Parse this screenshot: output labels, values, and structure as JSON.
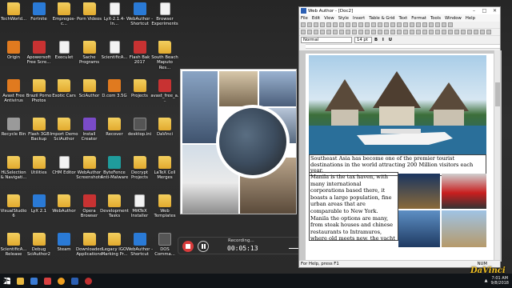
{
  "desktop": {
    "icons": [
      {
        "label": "TechWorld...",
        "kind": "folder"
      },
      {
        "label": "Fortnite",
        "kind": "blue"
      },
      {
        "label": "Empregos-c...",
        "kind": "folder"
      },
      {
        "label": "Porn Videos",
        "kind": "folder"
      },
      {
        "label": "LyX-2.1.4-In...",
        "kind": "doc"
      },
      {
        "label": "WebAuthor - Shortcut",
        "kind": "blue"
      },
      {
        "label": "Browser Experiments",
        "kind": "doc"
      },
      {
        "label": "Origin",
        "kind": "orange"
      },
      {
        "label": "Apowersoft Free Scre...",
        "kind": "red"
      },
      {
        "label": "Execulet",
        "kind": "doc"
      },
      {
        "label": "Sache Programs",
        "kind": "folder"
      },
      {
        "label": "ScientificA...",
        "kind": "doc"
      },
      {
        "label": "Flash Bak 2017",
        "kind": "red"
      },
      {
        "label": "South Beach Maputo Res...",
        "kind": "folder"
      },
      {
        "label": "Avast Free Antivirus",
        "kind": "orange"
      },
      {
        "label": "Brazil Porno Photos",
        "kind": "folder"
      },
      {
        "label": "Exotic Cars",
        "kind": "folder"
      },
      {
        "label": "SciAuthor",
        "kind": "folder"
      },
      {
        "label": "D.com 3.5G",
        "kind": "orange"
      },
      {
        "label": "Projects",
        "kind": "folder"
      },
      {
        "label": "avast_free_a...",
        "kind": "red"
      },
      {
        "label": "Recycle Bin",
        "kind": "grey"
      },
      {
        "label": "Flash 3GB Backup",
        "kind": "folder"
      },
      {
        "label": "Import Demo SciAuthor",
        "kind": "folder"
      },
      {
        "label": "Install Creator",
        "kind": "purple"
      },
      {
        "label": "Recover",
        "kind": "folder"
      },
      {
        "label": "desktop.ini",
        "kind": "dark"
      },
      {
        "label": "DaVinci",
        "kind": "folder"
      },
      {
        "label": "HLSelection & Navigati...",
        "kind": "folder"
      },
      {
        "label": "Utilities",
        "kind": "folder"
      },
      {
        "label": "CHM Editor",
        "kind": "doc"
      },
      {
        "label": "WebAuthor Screenshots",
        "kind": "folder"
      },
      {
        "label": "ByteFence Anti-Malware",
        "kind": "teal"
      },
      {
        "label": "Decrypt Projects",
        "kind": "folder"
      },
      {
        "label": "LaTeX Cell Merges",
        "kind": "folder"
      },
      {
        "label": "VisualStudio6",
        "kind": "folder"
      },
      {
        "label": "LyX 2.1",
        "kind": "blue"
      },
      {
        "label": "WebAuthor",
        "kind": "folder"
      },
      {
        "label": "Opera Browser",
        "kind": "red"
      },
      {
        "label": "Development Tasks",
        "kind": "folder"
      },
      {
        "label": "MiKTeX Installer",
        "kind": "doc"
      },
      {
        "label": "Web Templates",
        "kind": "folder"
      },
      {
        "label": "ScientificA... Release",
        "kind": "folder"
      },
      {
        "label": "Debug SciAuthor2",
        "kind": "folder"
      },
      {
        "label": "Steam",
        "kind": "blue"
      },
      {
        "label": "Downloaded Applications",
        "kind": "folder"
      },
      {
        "label": "Legacy IGO Marking Pr...",
        "kind": "folder"
      },
      {
        "label": "WebAuthor - Shortcut",
        "kind": "blue"
      },
      {
        "label": "DOS Comma...",
        "kind": "dark"
      },
      {
        "label": "High-Logic FontCreator",
        "kind": "red"
      }
    ]
  },
  "recorder": {
    "status": "Recording...",
    "time": "00:05:13",
    "volume": 0.65
  },
  "app": {
    "title": "Web Author - [Doc2]",
    "menu": [
      "File",
      "Edit",
      "View",
      "Style",
      "Insert",
      "Table & Grid",
      "Text",
      "Format",
      "Tools",
      "Window",
      "Help"
    ],
    "style_value": "Normal",
    "font_size_value": "14 pt",
    "caption": "Southeast Asia has become one of the premier tourist destinations in the world attracting 200 Million visitors each year.",
    "body": "Manila is the tax haven, with many international corporations based there, it boasts a large population, fine urban areas that are comparable to New York. Manila the options are many, from steak houses and chinese restaurants to Intramuros, where old meets new, the yacht club, sgh",
    "status_left": "For Help, press F1",
    "status_right": "NUM"
  },
  "taskbar": {
    "time": "7:01 AM",
    "date": "9/8/2018",
    "watermark": "DaVinci"
  }
}
